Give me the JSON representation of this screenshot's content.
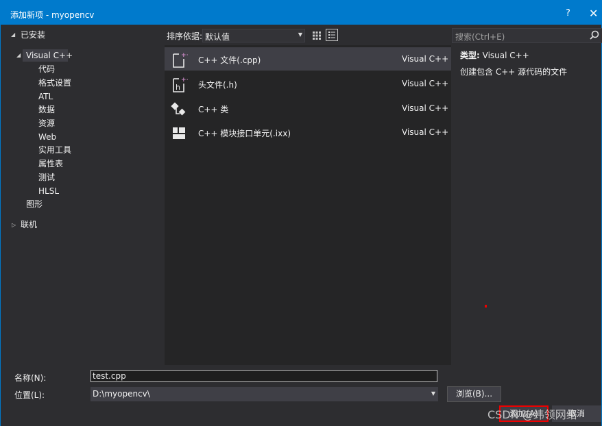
{
  "window": {
    "title": "添加新项 - myopencv",
    "help": "?",
    "close": "✕"
  },
  "tree": {
    "installed": "已安装",
    "visual_cpp": "Visual C++",
    "children": [
      "代码",
      "格式设置",
      "ATL",
      "数据",
      "资源",
      "Web",
      "实用工具",
      "属性表",
      "测试",
      "HLSL"
    ],
    "graphics": "图形",
    "online": "联机"
  },
  "toolbar": {
    "sort_label": "排序依据:",
    "sort_value": "默认值"
  },
  "search": {
    "placeholder": "搜索(Ctrl+E)"
  },
  "items": [
    {
      "name": "C++ 文件(.cpp)",
      "lang": "Visual C++",
      "icon": "cpp-file-icon",
      "selected": true
    },
    {
      "name": "头文件(.h)",
      "lang": "Visual C++",
      "icon": "header-file-icon"
    },
    {
      "name": "C++ 类",
      "lang": "Visual C++",
      "icon": "class-icon"
    },
    {
      "name": "C++ 模块接口单元(.ixx)",
      "lang": "Visual C++",
      "icon": "module-icon"
    }
  ],
  "details": {
    "type_label": "类型:",
    "type_value": "Visual C++",
    "description": "创建包含 C++ 源代码的文件"
  },
  "form": {
    "name_label": "名称(N):",
    "name_value": "test.cpp",
    "location_label": "位置(L):",
    "location_value": "D:\\myopencv\\",
    "browse": "浏览(B)...",
    "add": "添加(A)",
    "cancel": "取消"
  },
  "watermark": "CSDN @纬领网络",
  "colors": {
    "accent": "#007acc",
    "highlight": "#e00000"
  }
}
